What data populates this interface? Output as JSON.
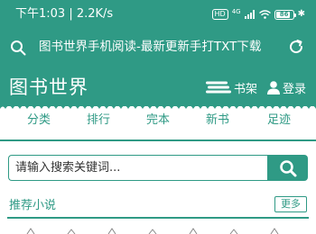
{
  "status_bar": {
    "time_speed": "下午1:03 | 2.2K/s",
    "hd": "HD",
    "network": "4G",
    "battery": "86",
    "bluetooth": "✱"
  },
  "browser": {
    "url_text": "图书世界手机阅读-最新更新手打TXT下载",
    "search_icon": "search-icon",
    "reload_icon": "reload-icon"
  },
  "header": {
    "site_title": "图书世界",
    "shelf_label": "书架",
    "login_label": "登录"
  },
  "nav": {
    "items": [
      "分类",
      "排行",
      "完本",
      "新书",
      "足迹"
    ]
  },
  "search": {
    "placeholder": "请输入搜索关键词..."
  },
  "recommend": {
    "title": "推荐小说",
    "more_label": "更多"
  },
  "colors": {
    "primary": "#2f9a85",
    "background": "#ffffff"
  }
}
